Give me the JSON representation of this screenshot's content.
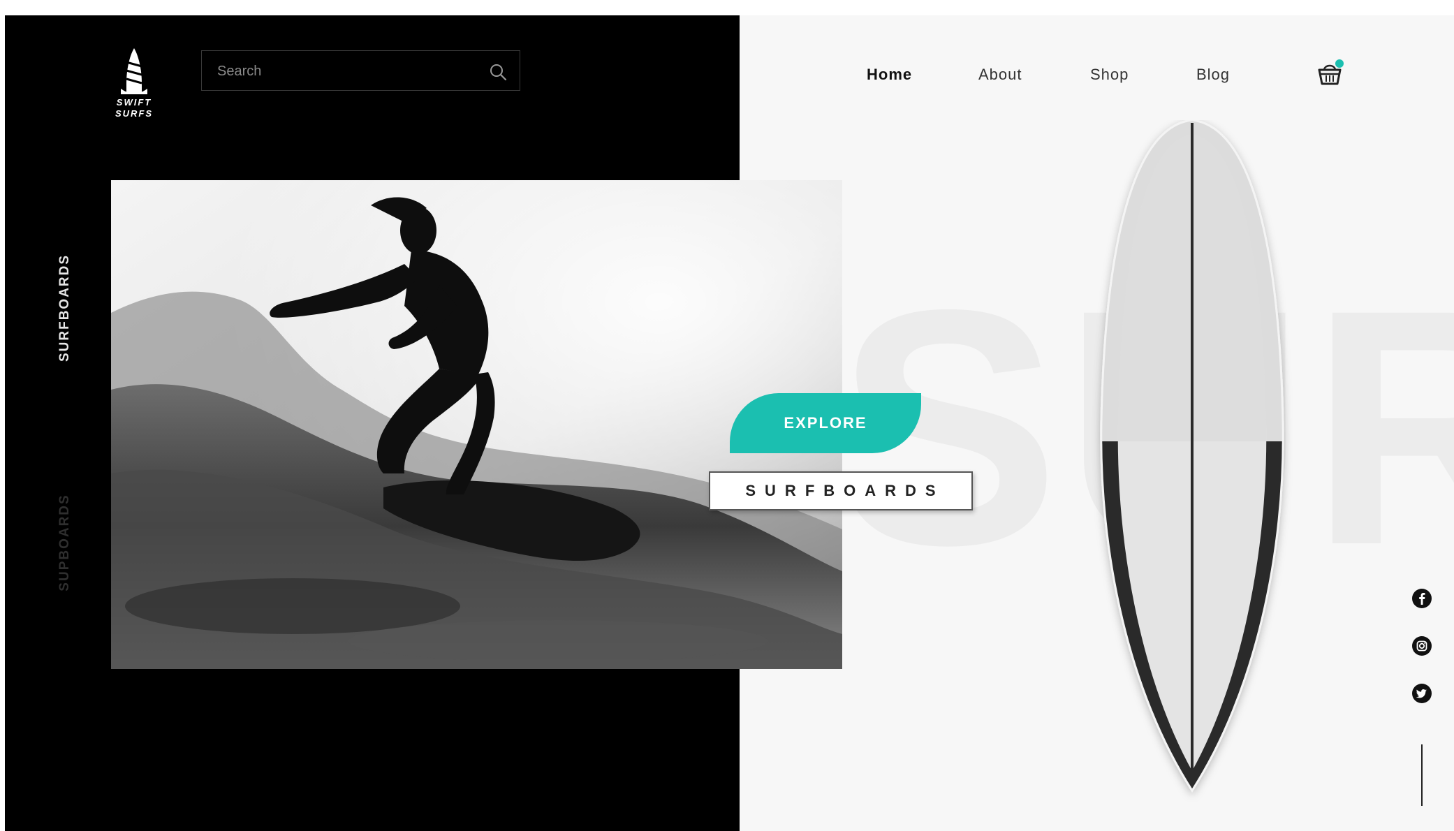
{
  "brand": {
    "name_line1": "SWIFT",
    "name_line2": "SURFS"
  },
  "search": {
    "placeholder": "Search",
    "value": ""
  },
  "side_tabs": [
    {
      "label": "SURFBOARDS",
      "active": true
    },
    {
      "label": "SUPBOARDS",
      "active": false
    }
  ],
  "nav": {
    "items": [
      {
        "label": "Home",
        "active": true
      },
      {
        "label": "About",
        "active": false
      },
      {
        "label": "Shop",
        "active": false
      },
      {
        "label": "Blog",
        "active": false
      }
    ],
    "cart_icon": "basket-icon",
    "cart_badge_color": "#1bbfb0"
  },
  "hero": {
    "background_word": "SURF",
    "cta_label": "EXPLORE",
    "tagline": "SURFBOARDS",
    "image": "surfer-riding-wave-photo"
  },
  "social": [
    "facebook-icon",
    "instagram-icon",
    "twitter-icon"
  ],
  "colors": {
    "accent": "#1bbfb0",
    "dark": "#000000",
    "light": "#f7f7f7"
  }
}
